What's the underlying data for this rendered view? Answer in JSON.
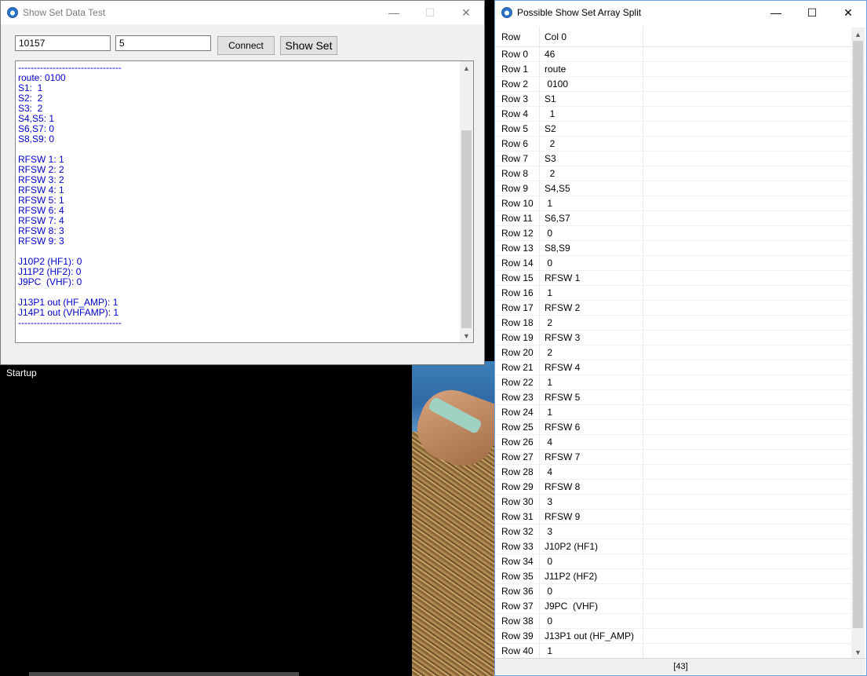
{
  "desktop": {
    "startup_label": "Startup"
  },
  "window1": {
    "title": "Show Set Data Test",
    "caption": {
      "minimize": "—",
      "maximize": "☐",
      "close": "✕"
    },
    "port_value": "10157",
    "count_value": "5",
    "connect_label": "Connect",
    "showset_label": "Show Set",
    "output_lines": [
      "---------------------------------",
      "route: 0100",
      "S1:  1",
      "S2:  2",
      "S3:  2",
      "S4,S5: 1",
      "S6,S7: 0",
      "S8,S9: 0",
      "",
      "RFSW 1: 1",
      "RFSW 2: 2",
      "RFSW 3: 2",
      "RFSW 4: 1",
      "RFSW 5: 1",
      "RFSW 6: 4",
      "RFSW 7: 4",
      "RFSW 8: 3",
      "RFSW 9: 3",
      "",
      "J10P2 (HF1): 0",
      "J11P2 (HF2): 0",
      "J9PC  (VHF): 0",
      "",
      "J13P1 out (HF_AMP): 1",
      "J14P1 out (VHFAMP): 1",
      "---------------------------------"
    ]
  },
  "window2": {
    "title": "Possible Show Set Array Split",
    "caption": {
      "minimize": "—",
      "maximize": "☐",
      "close": "✕"
    },
    "header": {
      "row": "Row",
      "col": "Col 0"
    },
    "rows": [
      [
        "Row 0",
        "46"
      ],
      [
        "Row 1",
        "route"
      ],
      [
        "Row 2",
        " 0100"
      ],
      [
        "Row 3",
        "S1"
      ],
      [
        "Row 4",
        "  1"
      ],
      [
        "Row 5",
        "S2"
      ],
      [
        "Row 6",
        "  2"
      ],
      [
        "Row 7",
        "S3"
      ],
      [
        "Row 8",
        "  2"
      ],
      [
        "Row 9",
        "S4,S5"
      ],
      [
        "Row 10",
        " 1"
      ],
      [
        "Row 11",
        "S6,S7"
      ],
      [
        "Row 12",
        " 0"
      ],
      [
        "Row 13",
        "S8,S9"
      ],
      [
        "Row 14",
        " 0"
      ],
      [
        "Row 15",
        "RFSW 1"
      ],
      [
        "Row 16",
        " 1"
      ],
      [
        "Row 17",
        "RFSW 2"
      ],
      [
        "Row 18",
        " 2"
      ],
      [
        "Row 19",
        "RFSW 3"
      ],
      [
        "Row 20",
        " 2"
      ],
      [
        "Row 21",
        "RFSW 4"
      ],
      [
        "Row 22",
        " 1"
      ],
      [
        "Row 23",
        "RFSW 5"
      ],
      [
        "Row 24",
        " 1"
      ],
      [
        "Row 25",
        "RFSW 6"
      ],
      [
        "Row 26",
        " 4"
      ],
      [
        "Row 27",
        "RFSW 7"
      ],
      [
        "Row 28",
        " 4"
      ],
      [
        "Row 29",
        "RFSW 8"
      ],
      [
        "Row 30",
        " 3"
      ],
      [
        "Row 31",
        "RFSW 9"
      ],
      [
        "Row 32",
        " 3"
      ],
      [
        "Row 33",
        "J10P2 (HF1)"
      ],
      [
        "Row 34",
        " 0"
      ],
      [
        "Row 35",
        "J11P2 (HF2)"
      ],
      [
        "Row 36",
        " 0"
      ],
      [
        "Row 37",
        "J9PC  (VHF)"
      ],
      [
        "Row 38",
        " 0"
      ],
      [
        "Row 39",
        "J13P1 out (HF_AMP)"
      ],
      [
        "Row 40",
        " 1"
      ]
    ],
    "status": "[43]"
  }
}
